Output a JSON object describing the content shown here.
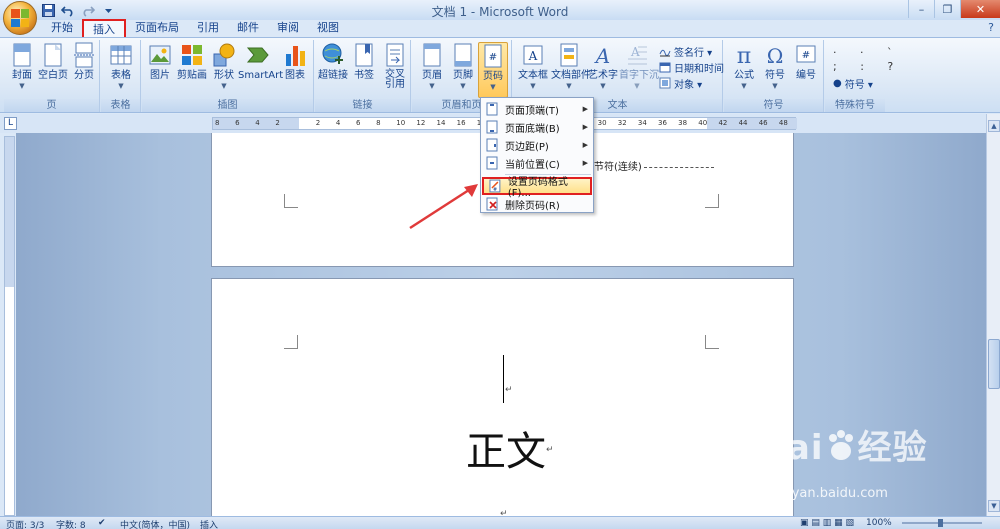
{
  "window": {
    "title": "文档 1 - Microsoft Word",
    "controls": [
      "–",
      "❐",
      "✕"
    ]
  },
  "quick_access": [
    "save-icon",
    "undo-icon",
    "redo-icon",
    "customize-icon"
  ],
  "tabs": [
    {
      "label": "开始",
      "active": false
    },
    {
      "label": "插入",
      "active": true
    },
    {
      "label": "页面布局",
      "active": false
    },
    {
      "label": "引用",
      "active": false
    },
    {
      "label": "邮件",
      "active": false
    },
    {
      "label": "审阅",
      "active": false
    },
    {
      "label": "视图",
      "active": false
    }
  ],
  "ribbon": {
    "groups": [
      {
        "label": "页",
        "buttons": [
          "封面",
          "空白页",
          "分页"
        ]
      },
      {
        "label": "表格",
        "buttons": [
          "表格"
        ]
      },
      {
        "label": "插图",
        "buttons": [
          "图片",
          "剪贴画",
          "形状",
          "SmartArt",
          "图表"
        ]
      },
      {
        "label": "链接",
        "buttons": [
          "超链接",
          "书签",
          "交叉\n引用"
        ]
      },
      {
        "label": "页眉和页",
        "buttons": [
          "页眉",
          "页脚",
          "页码"
        ]
      },
      {
        "label": "文本",
        "buttons": [
          "文本框",
          "文档部件",
          "艺术字",
          "首字下沉"
        ]
      },
      {
        "label": "符号",
        "buttons": [
          "公式",
          "符号",
          "编号"
        ]
      },
      {
        "label": "特殊符号",
        "buttons": []
      }
    ],
    "text_small": [
      "签名行 ▾",
      "日期和时间",
      "对象 ▾"
    ],
    "special_small": "符号 ▾"
  },
  "ruler": {
    "ticks": [
      "8",
      "6",
      "4",
      "2",
      "",
      "2",
      "4",
      "6",
      "8",
      "10",
      "12",
      "14",
      "16",
      "18",
      "20",
      "22",
      "24",
      "26",
      "28",
      "30",
      "32",
      "34",
      "36",
      "38",
      "40",
      "42",
      "44",
      "46",
      "48"
    ]
  },
  "document": {
    "section_break": "节符(连续)",
    "para_mark": "↵",
    "body_text": "正文"
  },
  "page_number_menu": {
    "items": [
      {
        "label": "页面顶端(T)",
        "submenu": true,
        "highlighted": false
      },
      {
        "label": "页面底端(B)",
        "submenu": true,
        "highlighted": false
      },
      {
        "label": "页边距(P)",
        "submenu": true,
        "highlighted": false
      },
      {
        "label": "当前位置(C)",
        "submenu": true,
        "highlighted": false
      },
      {
        "label": "设置页码格式(F)...",
        "submenu": false,
        "highlighted": true
      },
      {
        "label": "删除页码(R)",
        "submenu": false,
        "highlighted": false
      }
    ]
  },
  "status": {
    "page": "页面: 3/3",
    "words": "字数: 8",
    "language": "中文(简体，中国)",
    "mode": "插入",
    "zoom": "100%"
  },
  "watermark": {
    "brand": "Bai",
    "brand2": "经验",
    "url": "jingyan.baidu.com"
  },
  "colors": {
    "accent_red": "#e02020",
    "highlight": "#ffe08a",
    "ribbon_text": "#15428b"
  }
}
